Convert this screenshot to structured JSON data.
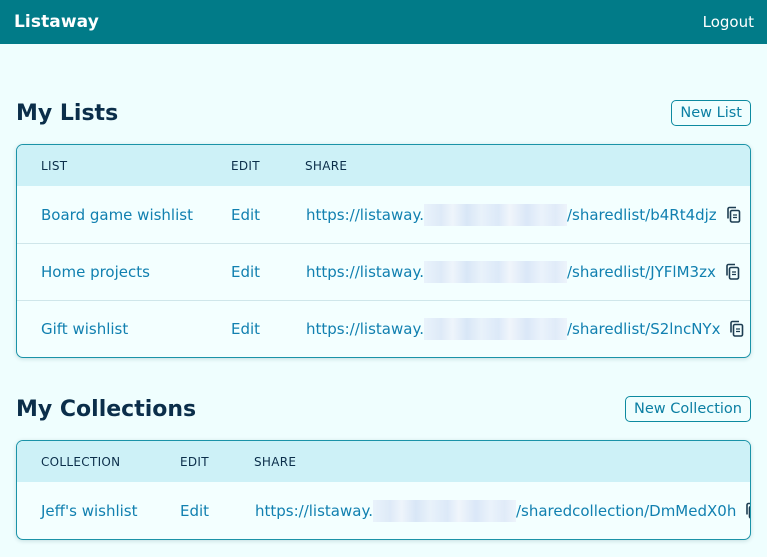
{
  "app": {
    "brand": "Listaway",
    "logout_label": "Logout"
  },
  "lists": {
    "title": "My Lists",
    "new_button": "New List",
    "headers": [
      "LIST",
      "EDIT",
      "SHARE"
    ],
    "rows": [
      {
        "name": "Board game wishlist",
        "edit": "Edit",
        "share_prefix": "https://listaway.",
        "share_suffix": "/sharedlist/b4Rt4djz"
      },
      {
        "name": "Home projects",
        "edit": "Edit",
        "share_prefix": "https://listaway.",
        "share_suffix": "/sharedlist/JYFlM3zx"
      },
      {
        "name": "Gift wishlist",
        "edit": "Edit",
        "share_prefix": "https://listaway.",
        "share_suffix": "/sharedlist/S2lncNYx"
      }
    ]
  },
  "collections": {
    "title": "My Collections",
    "new_button": "New Collection",
    "headers": [
      "COLLECTION",
      "EDIT",
      "SHARE"
    ],
    "rows": [
      {
        "name": "Jeff's wishlist",
        "edit": "Edit",
        "share_prefix": "https://listaway.",
        "share_suffix": "/sharedcollection/DmMedX0h"
      }
    ]
  },
  "icons": {
    "copy": "clipboard-copy-icon"
  },
  "colors": {
    "topbar": "#017b88",
    "background": "#effefe",
    "link": "#1180b0",
    "header_row": "#cdf1f7",
    "card_border": "#1b93a8"
  }
}
